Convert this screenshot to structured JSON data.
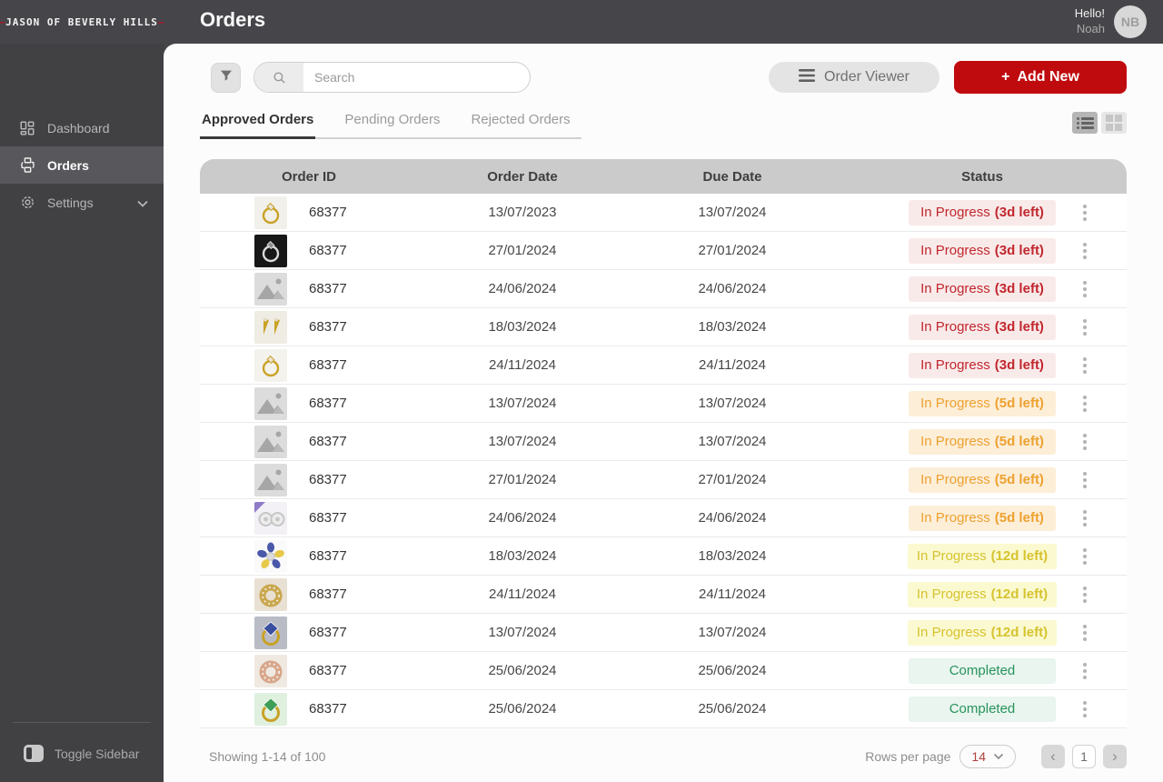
{
  "brand": {
    "dash": "—",
    "logo_text": "JASON OF BEVERLY HILLS",
    "accent_red": "#b11226"
  },
  "topbar": {
    "title": "Orders",
    "greeting": "Hello!",
    "username": "Noah",
    "avatar_initials": "NB"
  },
  "sidebar": {
    "items": [
      {
        "label": "Dashboard",
        "icon": "dashboard-grid-icon",
        "active": false
      },
      {
        "label": "Orders",
        "icon": "orders-flow-icon",
        "active": true
      },
      {
        "label": "Settings",
        "icon": "gear-icon",
        "active": false
      }
    ],
    "toggle_label": "Toggle Sidebar"
  },
  "controls": {
    "search_placeholder": "Search",
    "order_viewer_label": "Order Viewer",
    "add_new_icon": "+",
    "add_new_label": "Add New",
    "add_new_color": "#c00b0e"
  },
  "tabs": [
    {
      "label": "Approved Orders",
      "active": true
    },
    {
      "label": "Pending Orders",
      "active": false
    },
    {
      "label": "Rejected Orders",
      "active": false
    }
  ],
  "table": {
    "columns": [
      "Order ID",
      "Order Date",
      "Due Date",
      "Status"
    ],
    "rows": [
      {
        "order_id": "68377",
        "order_date": "13/07/2023",
        "due_date": "13/07/2024",
        "status": "In Progress",
        "status_detail": "(3d left)",
        "variant": "red",
        "thumb": {
          "shape": "ring",
          "bg": "#f2f0ea",
          "main": "#c9a227",
          "accent": "#e6e2d6"
        }
      },
      {
        "order_id": "68377",
        "order_date": "27/01/2024",
        "due_date": "27/01/2024",
        "status": "In Progress",
        "status_detail": "(3d left)",
        "variant": "red",
        "thumb": {
          "shape": "ring",
          "bg": "#171717",
          "main": "#d9d9d9",
          "accent": "#8c8c8c"
        }
      },
      {
        "order_id": "68377",
        "order_date": "24/06/2024",
        "due_date": "24/06/2024",
        "status": "In Progress",
        "status_detail": "(3d left)",
        "variant": "red",
        "thumb": {
          "shape": "placeholder",
          "bg": "#dcdcdc",
          "main": "#a6a6a6",
          "accent": "#b8b8b8"
        }
      },
      {
        "order_id": "68377",
        "order_date": "18/03/2024",
        "due_date": "18/03/2024",
        "status": "In Progress",
        "status_detail": "(3d left)",
        "variant": "red",
        "thumb": {
          "shape": "earrings",
          "bg": "#efece4",
          "main": "#c9a227",
          "accent": "#e3ddca"
        }
      },
      {
        "order_id": "68377",
        "order_date": "24/11/2024",
        "due_date": "24/11/2024",
        "status": "In Progress",
        "status_detail": "(3d left)",
        "variant": "red",
        "thumb": {
          "shape": "ring",
          "bg": "#f4f2ec",
          "main": "#c9a227",
          "accent": "#e6e2d6"
        }
      },
      {
        "order_id": "68377",
        "order_date": "13/07/2024",
        "due_date": "13/07/2024",
        "status": "In Progress",
        "status_detail": "(5d left)",
        "variant": "orange",
        "thumb": {
          "shape": "placeholder",
          "bg": "#dcdcdc",
          "main": "#a6a6a6",
          "accent": "#b8b8b8"
        }
      },
      {
        "order_id": "68377",
        "order_date": "13/07/2024",
        "due_date": "13/07/2024",
        "status": "In Progress",
        "status_detail": "(5d left)",
        "variant": "orange",
        "thumb": {
          "shape": "placeholder",
          "bg": "#dcdcdc",
          "main": "#a6a6a6",
          "accent": "#b8b8b8"
        }
      },
      {
        "order_id": "68377",
        "order_date": "27/01/2024",
        "due_date": "27/01/2024",
        "status": "In Progress",
        "status_detail": "(5d left)",
        "variant": "orange",
        "thumb": {
          "shape": "placeholder",
          "bg": "#dcdcdc",
          "main": "#a6a6a6",
          "accent": "#b8b8b8"
        }
      },
      {
        "order_id": "68377",
        "order_date": "24/06/2024",
        "due_date": "24/06/2024",
        "status": "In Progress",
        "status_detail": "(5d left)",
        "variant": "orange",
        "thumb": {
          "shape": "studs",
          "bg": "#f3f1f5",
          "main": "#c6c6c6",
          "accent": "#8f7cc9"
        }
      },
      {
        "order_id": "68377",
        "order_date": "18/03/2024",
        "due_date": "18/03/2024",
        "status": "In Progress",
        "status_detail": "(12d left)",
        "variant": "yellow",
        "thumb": {
          "shape": "flower",
          "bg": "#fafafa",
          "main": "#4958a8",
          "accent": "#e7c94a"
        }
      },
      {
        "order_id": "68377",
        "order_date": "24/11/2024",
        "due_date": "24/11/2024",
        "status": "In Progress",
        "status_detail": "(12d left)",
        "variant": "yellow",
        "thumb": {
          "shape": "band",
          "bg": "#e8e0d2",
          "main": "#c9a74e",
          "accent": "#efe7d2"
        }
      },
      {
        "order_id": "68377",
        "order_date": "13/07/2024",
        "due_date": "13/07/2024",
        "status": "In Progress",
        "status_detail": "(12d left)",
        "variant": "yellow",
        "thumb": {
          "shape": "gem",
          "bg": "#b9bcc4",
          "main": "#3a4fa0",
          "accent": "#c9a227"
        }
      },
      {
        "order_id": "68377",
        "order_date": "25/06/2024",
        "due_date": "25/06/2024",
        "status": "Completed",
        "status_detail": "",
        "variant": "green",
        "thumb": {
          "shape": "band",
          "bg": "#efe9e2",
          "main": "#d8a68a",
          "accent": "#f3ece2"
        }
      },
      {
        "order_id": "68377",
        "order_date": "25/06/2024",
        "due_date": "25/06/2024",
        "status": "Completed",
        "status_detail": "",
        "variant": "green",
        "thumb": {
          "shape": "gem",
          "bg": "#dff0df",
          "main": "#3f9e57",
          "accent": "#c9a227"
        }
      }
    ]
  },
  "status_variants": {
    "red": {
      "bg": "#f9eaea",
      "fg": "#c1272d"
    },
    "orange": {
      "bg": "#fdeed8",
      "fg": "#eda12f"
    },
    "yellow": {
      "bg": "#fbf9d0",
      "fg": "#d6c32f"
    },
    "green": {
      "bg": "#e9f5ee",
      "fg": "#27935d"
    }
  },
  "footer": {
    "showing": "Showing 1-14 of 100",
    "rows_per_page_label": "Rows per page",
    "rows_per_page_value": "14",
    "current_page": "1",
    "prev_icon": "‹",
    "next_icon": "›"
  }
}
